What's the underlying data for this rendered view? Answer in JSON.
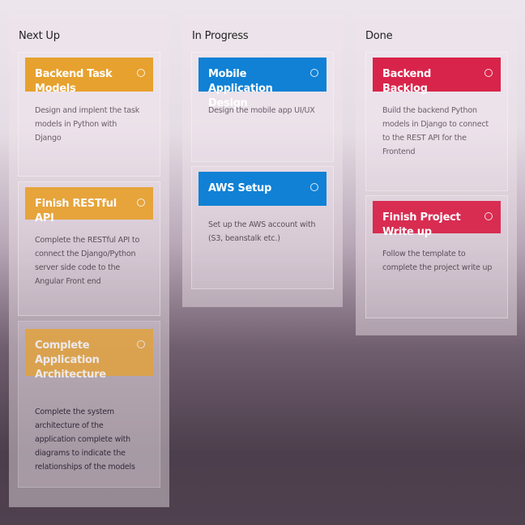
{
  "colors": {
    "orange": "#e7a12e",
    "blue": "#1081d5",
    "red": "#d8244a"
  },
  "columns": [
    {
      "title": "Next Up",
      "cards": [
        {
          "title": "Backend Task Models",
          "description": "Design and implent the task models in Python with Django",
          "color": "orange",
          "icon": "info-icon"
        },
        {
          "title": "Finish RESTful API",
          "description": "Complete the RESTful API to connect the Django/Python server side code to the Angular Front end",
          "color": "orange",
          "icon": "info-icon"
        },
        {
          "title": "Complete Application Architecture",
          "description": "Complete the system architecture of the application complete with diagrams to indicate the relationships of the models",
          "color": "orange",
          "icon": "info-icon"
        }
      ]
    },
    {
      "title": "In Progress",
      "cards": [
        {
          "title": "Mobile Application Design",
          "description": "Design the mobile app UI/UX",
          "color": "blue",
          "icon": "info-icon"
        },
        {
          "title": "AWS Setup",
          "description": "Set up the AWS account with (S3, beanstalk etc.)",
          "color": "blue",
          "icon": "info-icon"
        }
      ]
    },
    {
      "title": "Done",
      "cards": [
        {
          "title": "Backend Backlog",
          "description": "Build the backend Python models in Django to connect to the REST API for the Frontend",
          "color": "red",
          "icon": "info-icon"
        },
        {
          "title": "Finish Project Write up",
          "description": "Follow the template to complete the project write up",
          "color": "red",
          "icon": "info-icon"
        }
      ]
    }
  ]
}
